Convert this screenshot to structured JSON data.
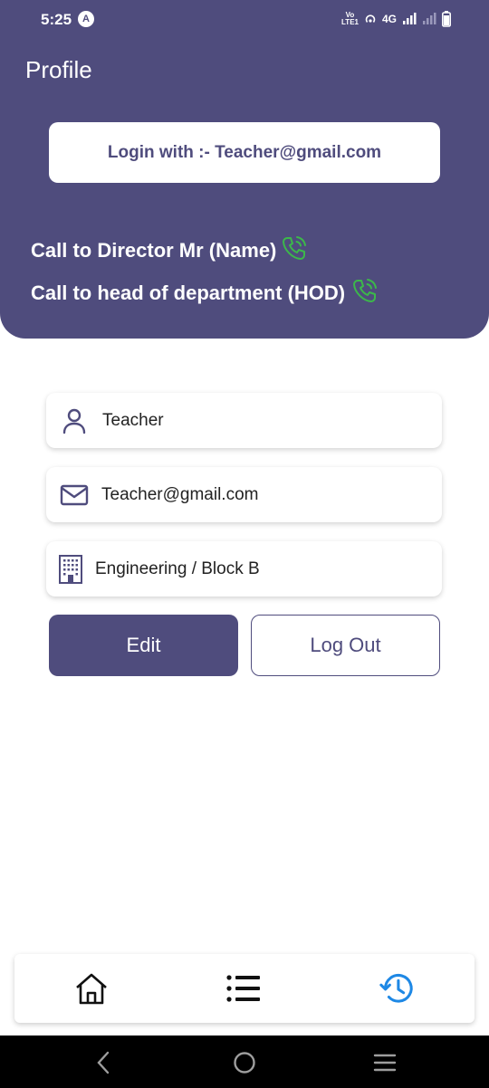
{
  "status_bar": {
    "time": "5:25",
    "network": "4G",
    "volte": "Vo))\nLTE1"
  },
  "header": {
    "title": "Profile",
    "login_text": "Login with :- Teacher@gmail.com",
    "call_director": "Call to Director Mr (Name)",
    "call_hod": "Call to head of department (HOD)",
    "call_icon_color": "#3cb84a"
  },
  "profile": {
    "name": "Teacher",
    "email": "Teacher@gmail.com",
    "department": "Engineering / Block B"
  },
  "actions": {
    "edit_label": "Edit",
    "logout_label": "Log Out"
  },
  "bottom_nav": {
    "items": [
      {
        "icon": "home-icon"
      },
      {
        "icon": "list-icon"
      },
      {
        "icon": "history-icon",
        "active": true,
        "color": "#1e88e5"
      }
    ]
  },
  "colors": {
    "primary": "#4f4c7d",
    "accent_green": "#3cb84a",
    "accent_blue": "#1e88e5"
  }
}
